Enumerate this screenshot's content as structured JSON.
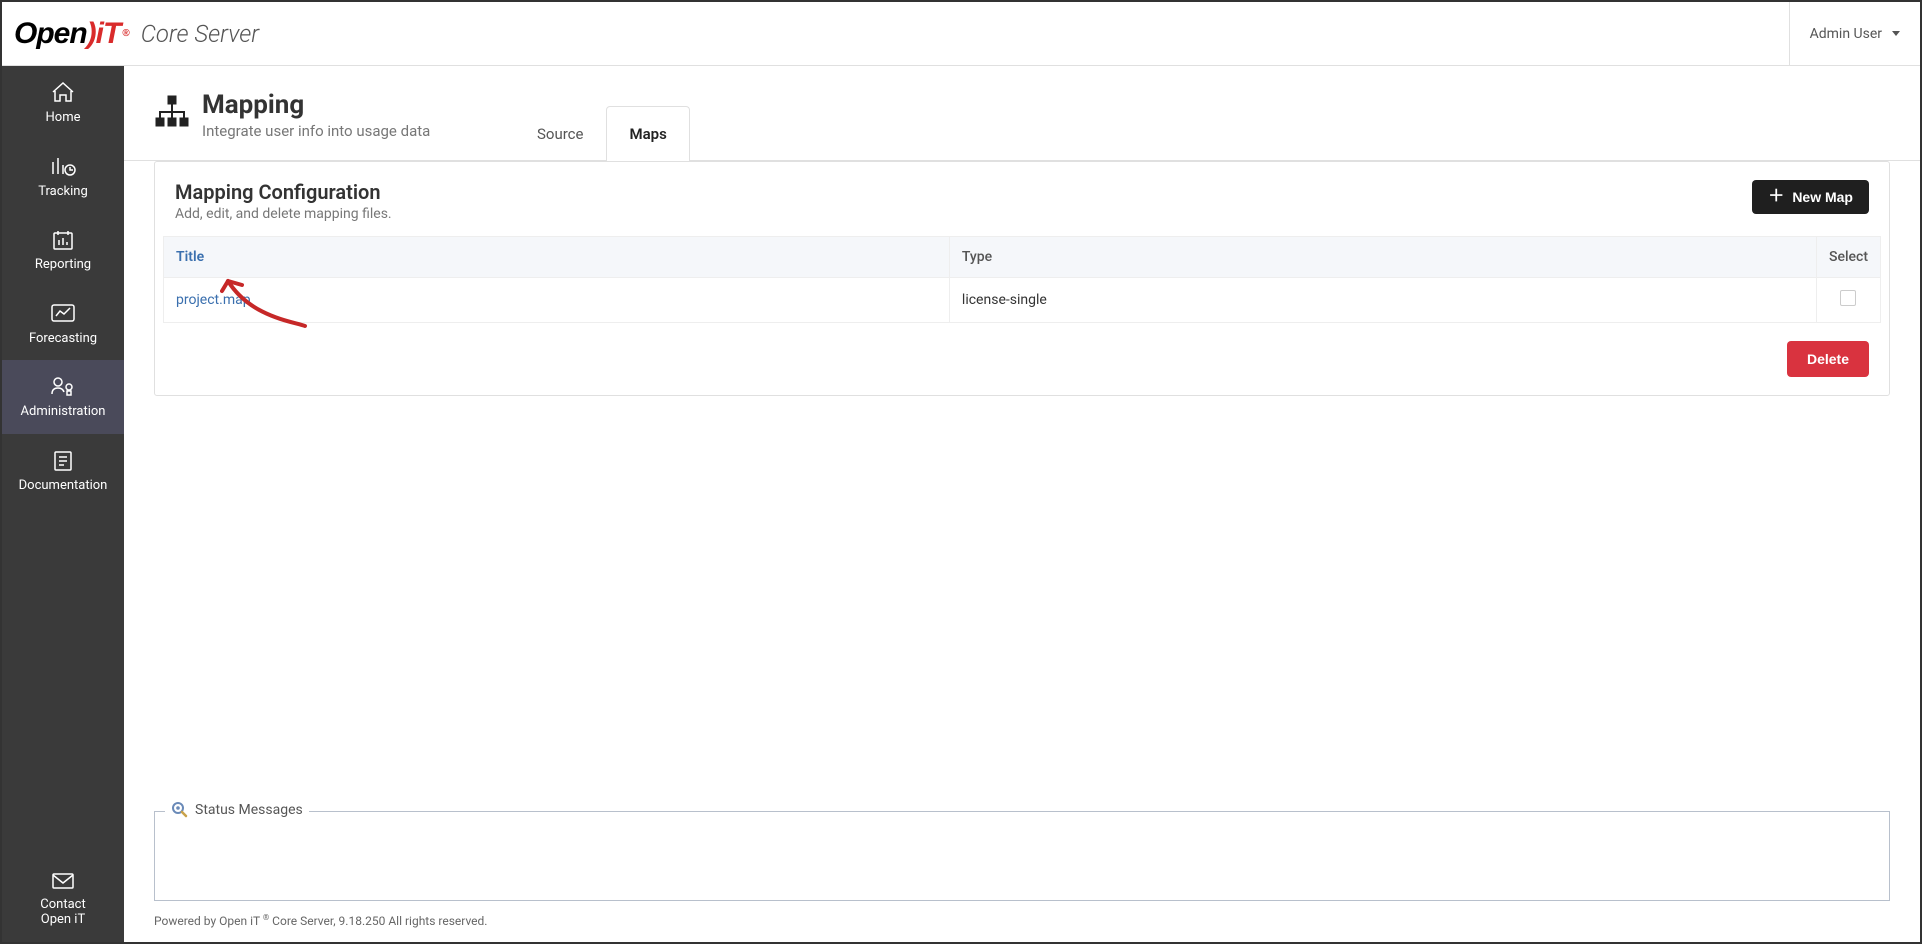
{
  "header": {
    "logo_open": "Open",
    "logo_it": "iT",
    "logo_reg": "®",
    "product": "Core Server",
    "user": "Admin User"
  },
  "sidebar": {
    "items": [
      {
        "label": "Home"
      },
      {
        "label": "Tracking"
      },
      {
        "label": "Reporting"
      },
      {
        "label": "Forecasting"
      },
      {
        "label": "Administration"
      },
      {
        "label": "Documentation"
      }
    ],
    "contact_line1": "Contact",
    "contact_line2": "Open iT"
  },
  "page": {
    "title": "Mapping",
    "subtitle": "Integrate user info into usage data",
    "tabs": {
      "source": "Source",
      "maps": "Maps"
    }
  },
  "card": {
    "title": "Mapping Configuration",
    "subtitle": "Add, edit, and delete mapping files.",
    "new_map": "New Map",
    "delete": "Delete",
    "columns": {
      "title": "Title",
      "type": "Type",
      "select": "Select"
    },
    "rows": [
      {
        "title": "project.map",
        "type": "license-single"
      }
    ]
  },
  "status": {
    "legend": "Status Messages"
  },
  "footer": {
    "prefix": "Powered by Open iT ",
    "reg": "®",
    "suffix": " Core Server, 9.18.250 All rights reserved."
  }
}
